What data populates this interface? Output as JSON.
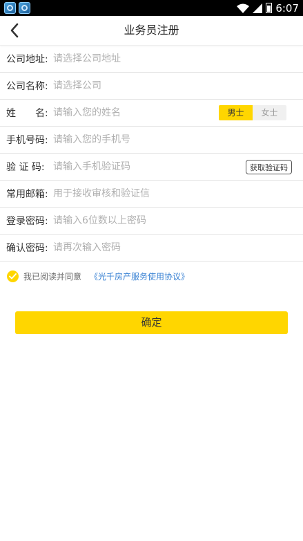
{
  "status_bar": {
    "time": "6:07"
  },
  "header": {
    "title": "业务员注册"
  },
  "form": {
    "company_address": {
      "label": "公司地址:",
      "placeholder": "请选择公司地址"
    },
    "company_name": {
      "label": "公司名称:",
      "placeholder": "请选择公司"
    },
    "name": {
      "label": "姓　　名:",
      "placeholder": "请输入您的姓名"
    },
    "gender": {
      "male": "男士",
      "female": "女士",
      "selected": "男士"
    },
    "phone": {
      "label": "手机号码:",
      "placeholder": "请输入您的手机号"
    },
    "code": {
      "label": "验 证 码:",
      "placeholder": "请输入手机验证码",
      "button": "获取验证码"
    },
    "email": {
      "label": "常用邮箱:",
      "placeholder": "用于接收审核和验证信"
    },
    "password": {
      "label": "登录密码:",
      "placeholder": "请输入6位数以上密码"
    },
    "confirm_password": {
      "label": "确认密码:",
      "placeholder": "请再次输入密码"
    }
  },
  "agreement": {
    "text": "我已阅读并同意",
    "link": "《光千房产服务使用协议》",
    "checked": true
  },
  "confirm_button": "确定",
  "colors": {
    "accent": "#ffd600",
    "link": "#3b83d4",
    "status_bar": "#000000"
  }
}
